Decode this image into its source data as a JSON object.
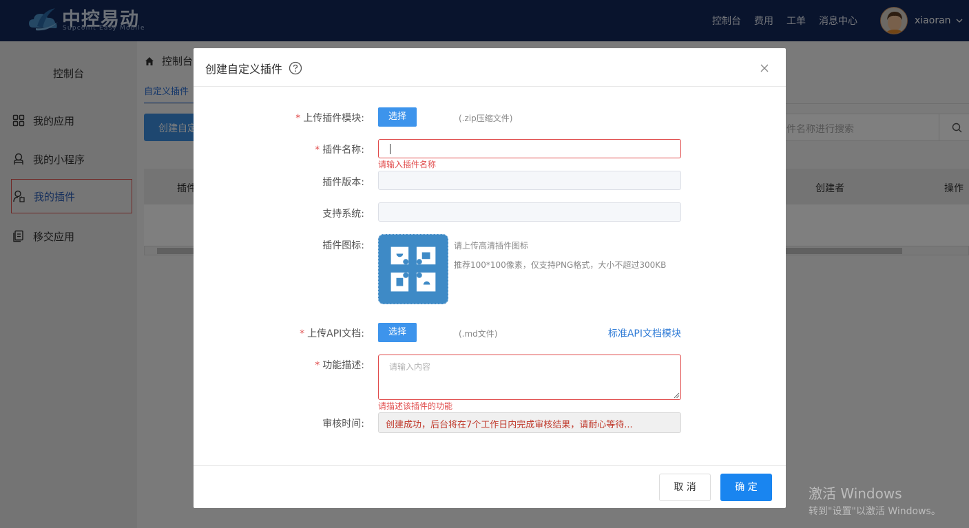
{
  "brand": {
    "name_cn": "中控易动",
    "name_en": "Supconit Easy Mobile"
  },
  "topnav": [
    "控制台",
    "费用",
    "工单",
    "消息中心"
  ],
  "user": {
    "name": "xiaoran"
  },
  "sidebar": {
    "title": "控制台",
    "items": [
      {
        "label": "我的应用",
        "icon": "grid-icon"
      },
      {
        "label": "我的小程序",
        "icon": "miniapp-icon"
      },
      {
        "label": "我的插件",
        "icon": "plugin-user-icon",
        "active": true
      },
      {
        "label": "移交应用",
        "icon": "transfer-icon"
      }
    ]
  },
  "main": {
    "breadcrumb": "控制台",
    "tab": "自定义插件",
    "create_button": "创建自定义插件",
    "search_placeholder": "件名称进行搜索",
    "table_headers": {
      "first": "插件",
      "creator": "创建者",
      "ops": "操作"
    }
  },
  "modal": {
    "title": "创建自定义插件",
    "upload_module": {
      "label": "上传插件模块:",
      "button": "选择",
      "hint": "(.zip压缩文件)"
    },
    "plugin_name": {
      "label": "插件名称:",
      "value": "",
      "error": "请输入插件名称"
    },
    "plugin_version": {
      "label": "插件版本:",
      "value": ""
    },
    "support_system": {
      "label": "支持系统:",
      "value": ""
    },
    "plugin_icon": {
      "label": "插件图标:",
      "hint1": "请上传高清插件图标",
      "hint2": "推荐100*100像素，仅支持PNG格式，大小不超过300KB"
    },
    "upload_api": {
      "label": "上传API文档:",
      "button": "选择",
      "hint": "(.md文件)",
      "link": "标准API文档模块"
    },
    "description": {
      "label": "功能描述:",
      "placeholder": "请输入内容",
      "error": "请描述该插件的功能"
    },
    "audit": {
      "label": "审核时间:",
      "value": "创建成功，后台将在7个工作日内完成审核结果，请耐心等待..."
    },
    "cancel": "取 消",
    "confirm": "确 定"
  },
  "watermark": {
    "line1": "激活 Windows",
    "line2": "转到\"设置\"以激活 Windows。"
  },
  "colors": {
    "header": "#12295a",
    "primary": "#1985f0",
    "error": "#e04a4a",
    "icon_bg": "#3e8ac6"
  }
}
